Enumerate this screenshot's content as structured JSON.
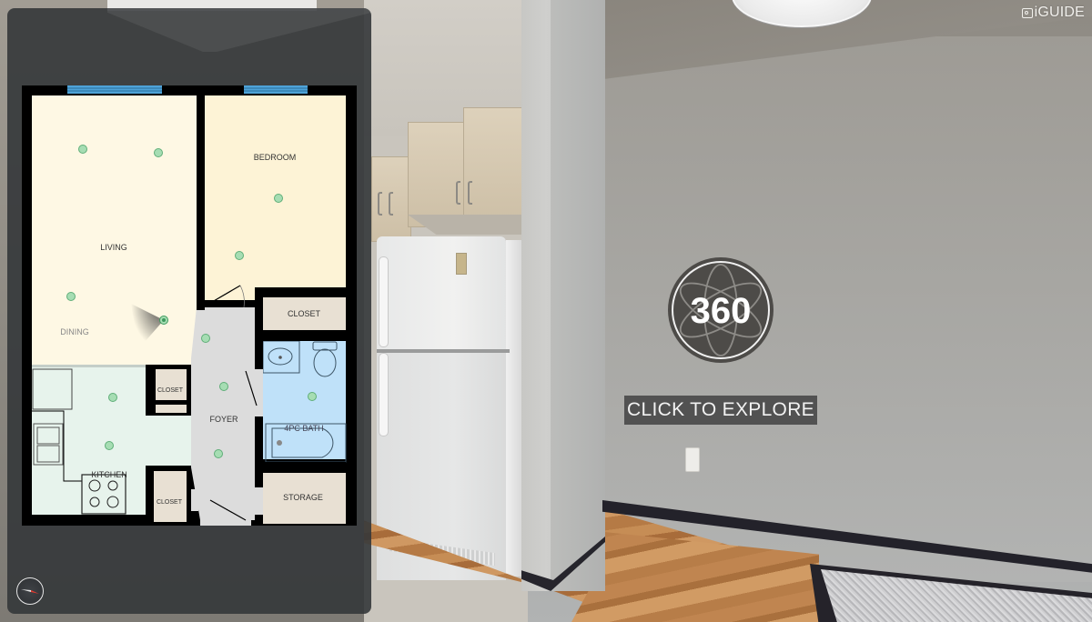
{
  "app": {
    "brand_label": "iGUIDE",
    "brand_icon": "camera-frame-icon"
  },
  "viewer": {
    "badge_text": "360",
    "badge_icon": "atom-orbit-icon",
    "explore_label": "CLICK TO EXPLORE"
  },
  "floorplan": {
    "colors": {
      "living": "#fef8e4",
      "bedroom": "#fdf3d6",
      "kitchen": "#e7f3ec",
      "foyer": "#dcdcdc",
      "bath": "#bfe1f9",
      "closet": "#e8e0d3",
      "wall": "#000000",
      "window": "#4ea3d8",
      "marker": "#a6ddb3",
      "marker_stroke": "#5fae78"
    },
    "rooms": [
      {
        "id": "living",
        "label": "LIVING"
      },
      {
        "id": "dining",
        "label": "DINING"
      },
      {
        "id": "bedroom",
        "label": "BEDROOM"
      },
      {
        "id": "closet-bedroom",
        "label": "CLOSET"
      },
      {
        "id": "closet-kitchen-upper",
        "label": "CLOSET"
      },
      {
        "id": "foyer",
        "label": "FOYER"
      },
      {
        "id": "bath",
        "label": "4PC BATH"
      },
      {
        "id": "kitchen",
        "label": "KITCHEN"
      },
      {
        "id": "closet-kitchen-lower",
        "label": "CLOSET"
      },
      {
        "id": "storage",
        "label": "STORAGE"
      }
    ],
    "pano_points_count": 13,
    "current_point": "living-dining"
  },
  "controls": {
    "compass_icon": "compass-icon"
  }
}
